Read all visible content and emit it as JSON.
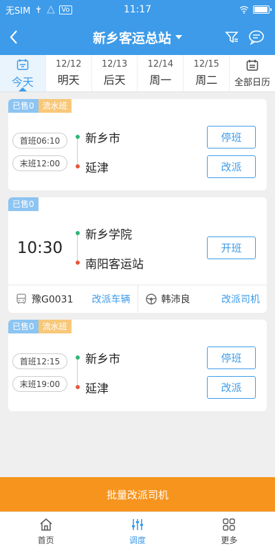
{
  "statusbar": {
    "carrier": "无SIM",
    "time": "11:17",
    "volte": "Vo"
  },
  "header": {
    "title": "新乡客运总站",
    "icons": [
      "back-icon",
      "filter-icon",
      "message-icon"
    ]
  },
  "dates": [
    {
      "date": "",
      "label": "今天",
      "active": true
    },
    {
      "date": "12/12",
      "label": "明天"
    },
    {
      "date": "12/13",
      "label": "后天"
    },
    {
      "date": "12/14",
      "label": "周一"
    },
    {
      "date": "12/15",
      "label": "周二"
    },
    {
      "date": "",
      "label": "全部日历"
    }
  ],
  "cards": [
    {
      "tags": [
        "已售0",
        "流水班"
      ],
      "first_shift": "首班06:10",
      "last_shift": "末班12:00",
      "from": "新乡市",
      "to": "延津",
      "buttons": [
        "停班",
        "改派"
      ]
    },
    {
      "tags": [
        "已售0"
      ],
      "time": "10:30",
      "from": "新乡学院",
      "to": "南阳客运站",
      "button": "开班",
      "vehicle": "豫G0031",
      "vehicle_action": "改派车辆",
      "driver": "韩沛良",
      "driver_action": "改派司机"
    },
    {
      "tags": [
        "已售0",
        "流水班"
      ],
      "first_shift": "首班12:15",
      "last_shift": "末班19:00",
      "from": "新乡市",
      "to": "延津",
      "buttons": [
        "停班",
        "改派"
      ]
    }
  ],
  "batch_button": "批量改派司机",
  "tabbar": [
    {
      "label": "首页",
      "icon": "home-icon"
    },
    {
      "label": "调度",
      "icon": "sliders-icon",
      "active": true
    },
    {
      "label": "更多",
      "icon": "grid-icon"
    }
  ],
  "colors": {
    "primary": "#3d9be9",
    "accent": "#f7941d",
    "sold_tag": "#8cc4f2",
    "flow_tag": "#f8c87a"
  }
}
